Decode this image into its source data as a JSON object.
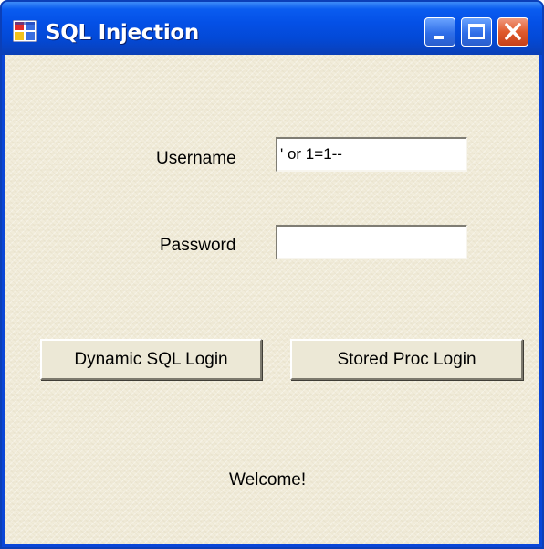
{
  "window": {
    "title": "SQL Injection",
    "icon": "winforms-app-icon",
    "controls": {
      "minimize_icon": "minimize-icon",
      "maximize_icon": "maximize-icon",
      "close_icon": "close-icon"
    },
    "colors": {
      "titlebar": "#0450e6",
      "close_button": "#e05a2c",
      "client_background": "#f1ecda"
    }
  },
  "form": {
    "username_label": "Username",
    "username_value": "' or 1=1--",
    "password_label": "Password",
    "password_value": ""
  },
  "buttons": {
    "dynamic_sql_label": "Dynamic SQL Login",
    "stored_proc_label": "Stored Proc Login"
  },
  "status": {
    "message": "Welcome!"
  }
}
